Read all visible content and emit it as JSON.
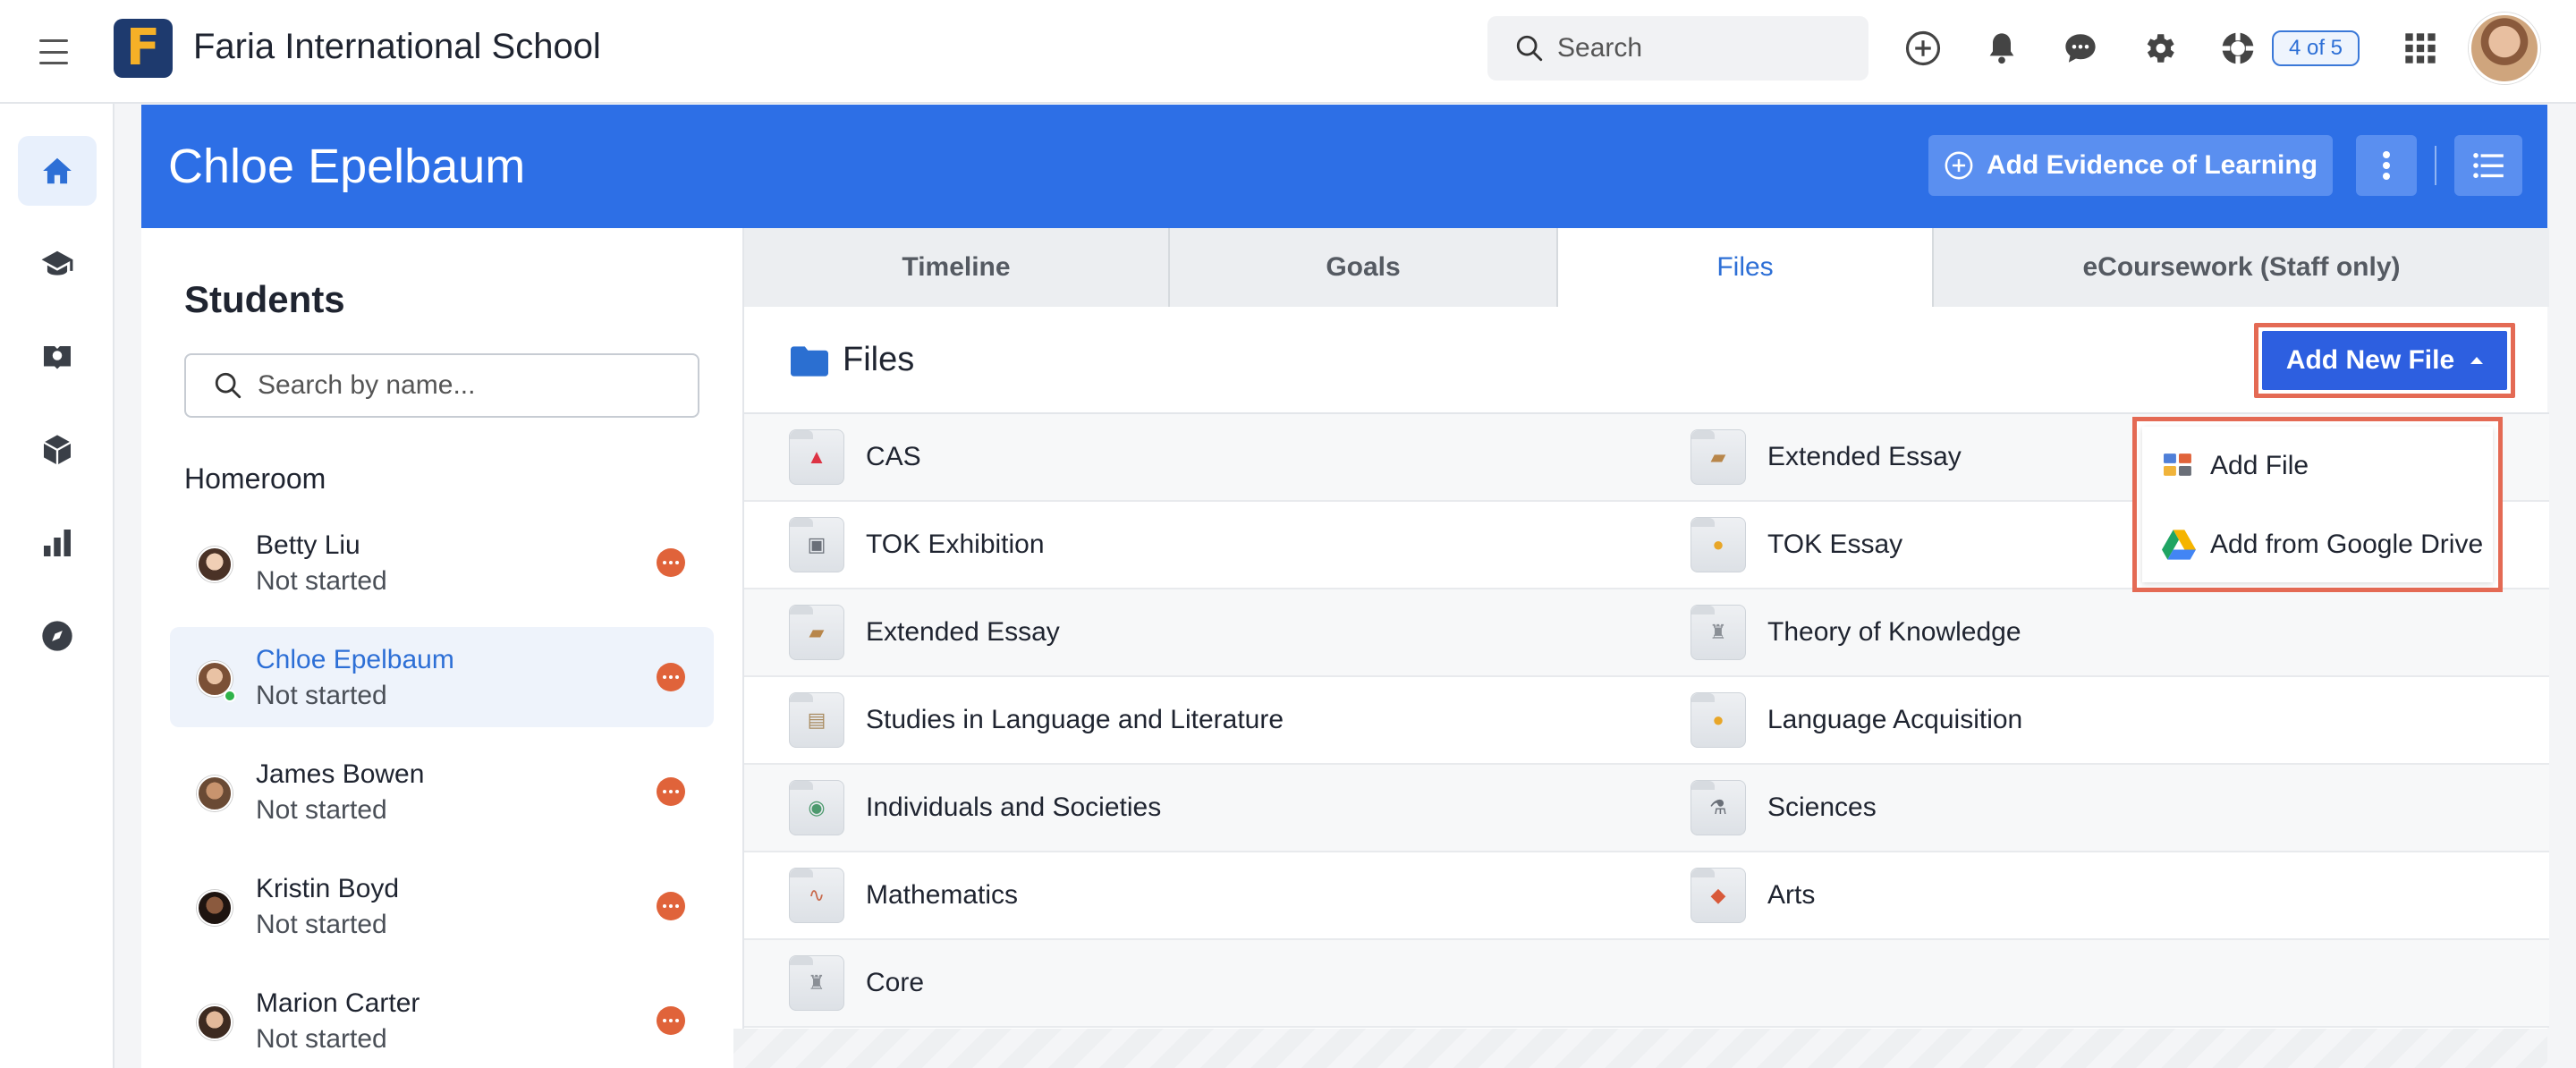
{
  "topbar": {
    "logo_letter": "F",
    "school_name": "Faria International School",
    "search_placeholder": "Search",
    "progress_badge": "4 of 5",
    "icons": [
      "add-circle-icon",
      "bell-icon",
      "chat-icon",
      "gear-icon",
      "help-lifebuoy-icon",
      "apps-grid-icon"
    ]
  },
  "rail": {
    "items": [
      "home-icon",
      "graduation-cap-icon",
      "map-book-icon",
      "cube-icon",
      "bar-chart-icon",
      "compass-icon"
    ],
    "active": "home-icon"
  },
  "banner": {
    "title": "Chloe Epelbaum",
    "add_evidence_label": "Add Evidence of Learning",
    "color": "#2d6fe6"
  },
  "students": {
    "title": "Students",
    "search_placeholder": "Search by name...",
    "group": "Homeroom",
    "list": [
      {
        "name": "Betty Liu",
        "status": "Not started",
        "selected": false
      },
      {
        "name": "Chloe Epelbaum",
        "status": "Not started",
        "selected": true
      },
      {
        "name": "James Bowen",
        "status": "Not started",
        "selected": false
      },
      {
        "name": "Kristin Boyd",
        "status": "Not started",
        "selected": false
      },
      {
        "name": "Marion Carter",
        "status": "Not started",
        "selected": false
      }
    ]
  },
  "tabs": [
    {
      "label": "Timeline",
      "active": false
    },
    {
      "label": "Goals",
      "active": false
    },
    {
      "label": "Files",
      "active": true
    },
    {
      "label": "eCoursework (Staff only)",
      "active": false
    }
  ],
  "files": {
    "title": "Files",
    "add_new_file_label": "Add New File",
    "folders": [
      [
        "CAS",
        "Extended Essay"
      ],
      [
        "TOK Exhibition",
        "TOK Essay"
      ],
      [
        "Extended Essay",
        "Theory of Knowledge"
      ],
      [
        "Studies in Language and Literature",
        "Language Acquisition"
      ],
      [
        "Individuals and Societies",
        "Sciences"
      ],
      [
        "Mathematics",
        "Arts"
      ],
      [
        "Core"
      ]
    ]
  },
  "dropdown": {
    "items": [
      {
        "label": "Add File",
        "icon": "add-file-icon"
      },
      {
        "label": "Add from Google Drive",
        "icon": "google-drive-icon"
      }
    ]
  },
  "colors": {
    "accent": "#2d6fd6",
    "highlight_border": "#e46a54",
    "status_more": "#e0633a"
  }
}
